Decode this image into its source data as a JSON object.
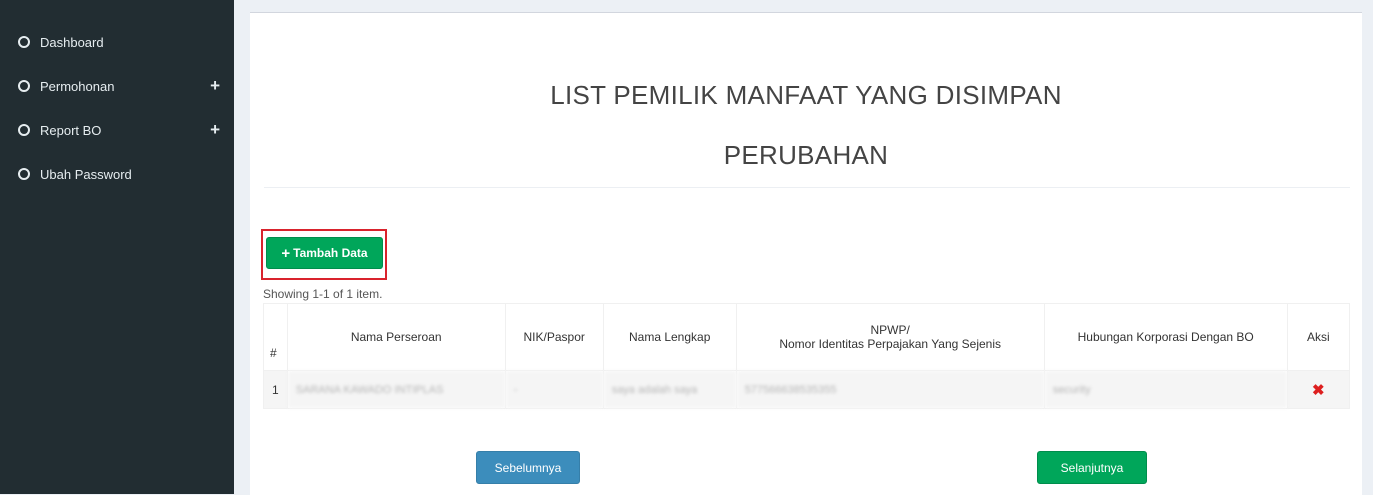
{
  "sidebar": {
    "items": [
      {
        "label": "Dashboard",
        "expandable": false
      },
      {
        "label": "Permohonan",
        "expandable": true
      },
      {
        "label": "Report BO",
        "expandable": true
      },
      {
        "label": "Ubah Password",
        "expandable": false
      }
    ]
  },
  "page": {
    "title_line1": "LIST PEMILIK MANFAAT YANG DISIMPAN",
    "title_line2": "PERUBAHAN"
  },
  "toolbar": {
    "add_label": "Tambah Data"
  },
  "summary": "Showing 1-1 of 1 item.",
  "table": {
    "headers": {
      "num": "#",
      "nama_perseroan": "Nama Perseroan",
      "nik": "NIK/Paspor",
      "nama_lengkap": "Nama Lengkap",
      "npwp_line1": "NPWP/",
      "npwp_line2": "Nomor Identitas Perpajakan Yang Sejenis",
      "hubungan": "Hubungan Korporasi Dengan BO",
      "aksi": "Aksi"
    },
    "rows": [
      {
        "num": "1",
        "nama_perseroan": "SARANA KAWADO INTIPLAS",
        "nik": "-",
        "nama_lengkap": "saya adalah saya",
        "npwp": "577566638535355",
        "hubungan": "security",
        "aksi_icon": "delete-icon"
      }
    ]
  },
  "footer": {
    "prev_label": "Sebelumnya",
    "next_label": "Selanjutnya"
  },
  "colors": {
    "sidebar_bg": "#222d32",
    "success": "#00a65a",
    "primary": "#3c8dbc",
    "danger": "#dd1f1f",
    "highlight_border": "#d9232d"
  }
}
